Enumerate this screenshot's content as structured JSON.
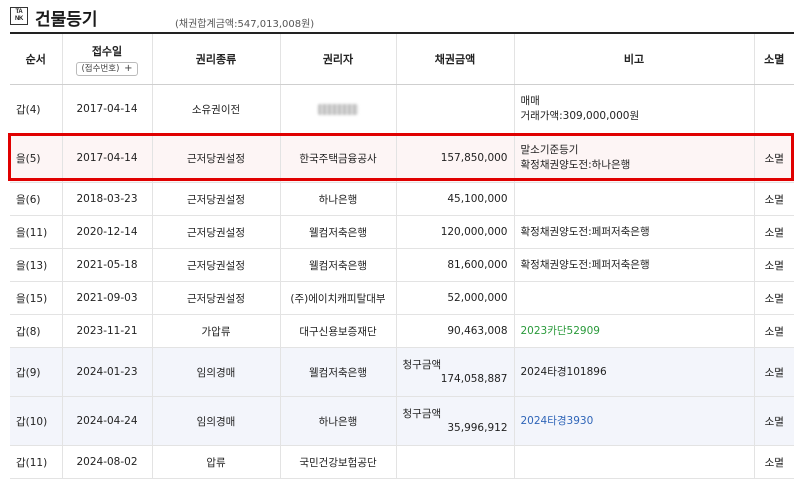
{
  "header": {
    "logo_lines": [
      "TA",
      "NK"
    ],
    "title": "건물등기",
    "subtitle": "(채권합계금액:547,013,008원)"
  },
  "columns": {
    "seq": "순서",
    "date": "접수일",
    "date_sub": "(접수번호)",
    "date_sub_plus": "+",
    "type": "권리종류",
    "holder": "권리자",
    "amount": "채권금액",
    "note": "비고",
    "extinct": "소멸"
  },
  "rows": [
    {
      "seq": "갑(4)",
      "date": "2017-04-14",
      "type": "소유권이전",
      "holder": "",
      "amount": "",
      "note_lines": [
        "매매",
        "거래가액:309,000,000원"
      ],
      "extinct": ""
    },
    {
      "seq": "을(5)",
      "date": "2017-04-14",
      "type": "근저당권설정",
      "holder": "한국주택금융공사",
      "amount": "157,850,000",
      "note_lines": [
        "말소기준등기",
        "확정채권양도전:하나은행"
      ],
      "extinct": "소멸"
    },
    {
      "seq": "을(6)",
      "date": "2018-03-23",
      "type": "근저당권설정",
      "holder": "하나은행",
      "amount": "45,100,000",
      "note_lines": [],
      "extinct": "소멸"
    },
    {
      "seq": "을(11)",
      "date": "2020-12-14",
      "type": "근저당권설정",
      "holder": "웰컴저축은행",
      "amount": "120,000,000",
      "note_lines": [
        "확정채권양도전:페퍼저축은행"
      ],
      "extinct": "소멸"
    },
    {
      "seq": "을(13)",
      "date": "2021-05-18",
      "type": "근저당권설정",
      "holder": "웰컴저축은행",
      "amount": "81,600,000",
      "note_lines": [
        "확정채권양도전:페퍼저축은행"
      ],
      "extinct": "소멸"
    },
    {
      "seq": "을(15)",
      "date": "2021-09-03",
      "type": "근저당권설정",
      "holder": "(주)에이치캐피탈대부",
      "amount": "52,000,000",
      "note_lines": [],
      "extinct": "소멸"
    },
    {
      "seq": "갑(8)",
      "date": "2023-11-21",
      "type": "가압류",
      "holder": "대구신용보증재단",
      "amount": "90,463,008",
      "note_lines": [
        "2023카단52909"
      ],
      "extinct": "소멸"
    },
    {
      "seq": "갑(9)",
      "date": "2024-01-23",
      "type": "임의경매",
      "holder": "웰컴저축은행",
      "amount_label": "청구금액",
      "amount": "174,058,887",
      "note_lines": [
        "2024타경101896"
      ],
      "extinct": "소멸"
    },
    {
      "seq": "갑(10)",
      "date": "2024-04-24",
      "type": "임의경매",
      "holder": "하나은행",
      "amount_label": "청구금액",
      "amount": "35,996,912",
      "note_lines": [
        "2024타경3930"
      ],
      "extinct": "소멸"
    },
    {
      "seq": "갑(11)",
      "date": "2024-08-02",
      "type": "압류",
      "holder": "국민건강보험공단",
      "amount": "",
      "note_lines": [],
      "extinct": "소멸"
    }
  ],
  "colors": {
    "highlight_border": "#e00000",
    "case_green": "#2a9a3b",
    "case_blue": "#2f65b8",
    "shaded_row": "#f3f5fb"
  }
}
